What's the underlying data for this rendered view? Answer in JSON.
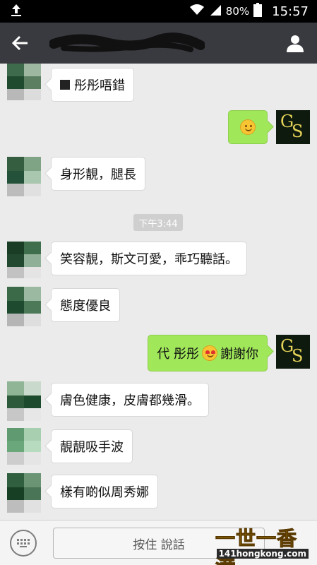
{
  "status_bar": {
    "battery": "80%",
    "time": "15:57"
  },
  "header": {
    "back_icon": "arrow-left-icon",
    "contact_icon": "person-icon"
  },
  "messages": [
    {
      "side": "left",
      "text": "彤彤唔錯",
      "prefix_icon": "black-square-icon"
    },
    {
      "side": "right",
      "emoji": "smile-emoji"
    },
    {
      "side": "left",
      "text": "身形靚，腿長"
    },
    {
      "side": "left",
      "text": "笑容靚，斯文可愛，乖巧聽話。"
    },
    {
      "side": "left",
      "text": "態度優良"
    },
    {
      "side": "right",
      "text_before": "代 彤彤",
      "emoji": "heart-eyes-emoji",
      "text_after": "謝謝你"
    },
    {
      "side": "left",
      "text": "膚色健康，皮膚都幾滑。"
    },
    {
      "side": "left",
      "text": "靚靚吸手波"
    },
    {
      "side": "left",
      "text": "樣有啲似周秀娜"
    }
  ],
  "timestamp": "下午3:44",
  "avatar_right_letters": {
    "g": "G",
    "s": "S"
  },
  "input": {
    "hold_to_talk": "按住 說話",
    "keyboard_icon": "keyboard-icon"
  },
  "watermark": {
    "big": "一世一香港",
    "small": "141hongkong.com"
  }
}
